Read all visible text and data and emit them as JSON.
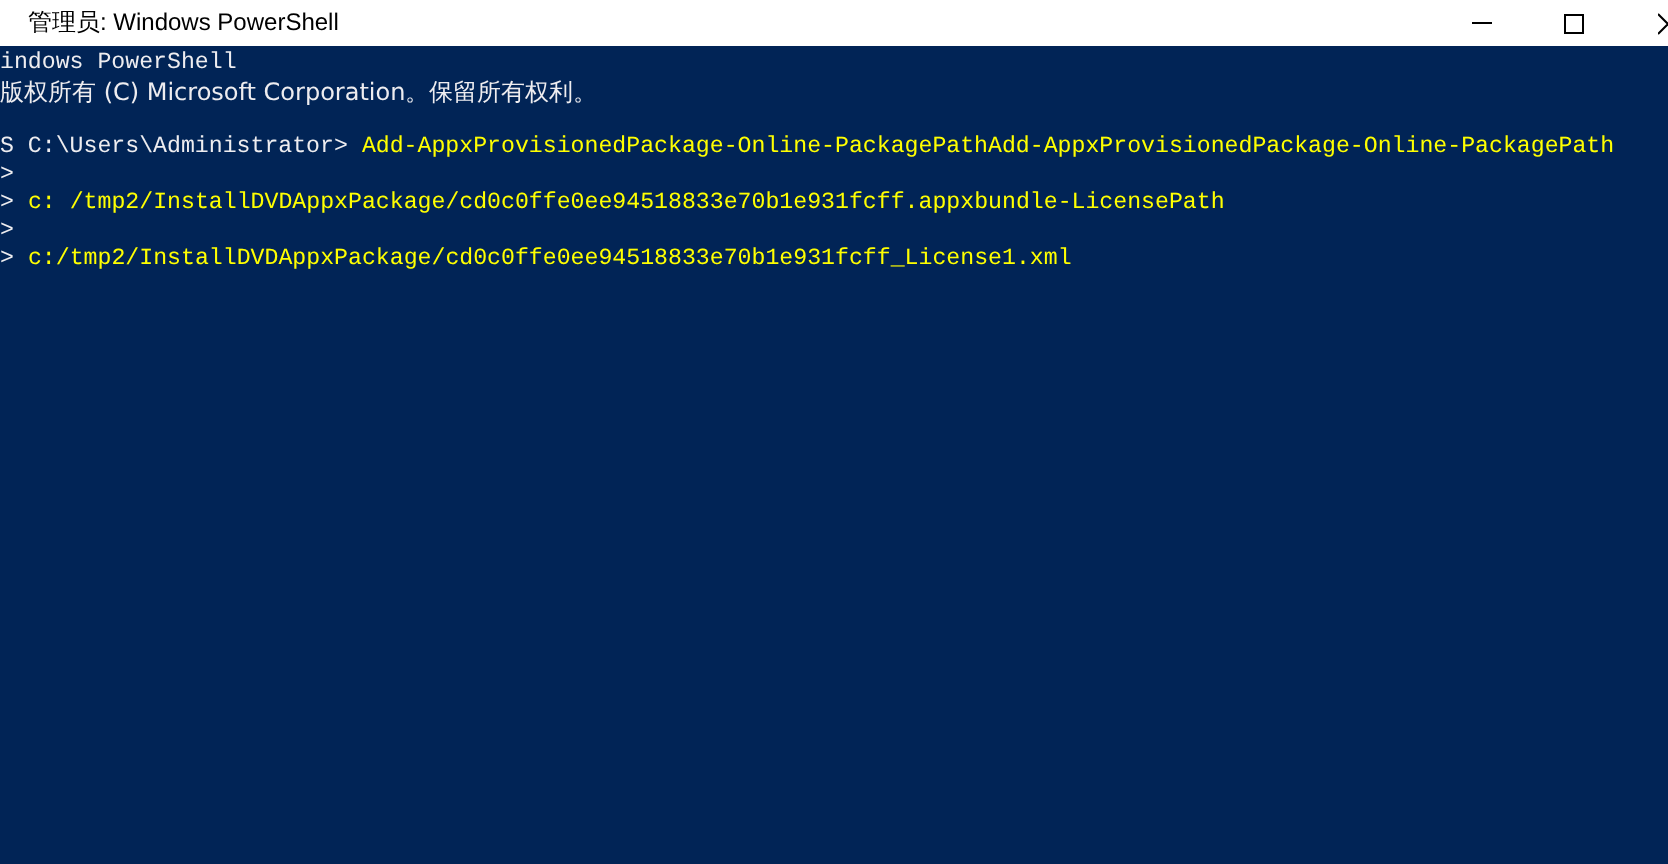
{
  "window": {
    "title": "管理员: Windows PowerShell"
  },
  "console": {
    "lines": [
      {
        "kind": "text",
        "segments": [
          {
            "text": "indows PowerShell",
            "kind": "output"
          }
        ]
      },
      {
        "kind": "text",
        "segments": [
          {
            "text": "版权所有 (C) Microsoft Corporation。保留所有权利。",
            "kind": "output"
          }
        ]
      },
      {
        "kind": "blank"
      },
      {
        "kind": "text",
        "segments": [
          {
            "text": "S C:\\Users\\Administrator>",
            "kind": "prompt"
          },
          {
            "text": "Add-AppxProvisionedPackage-Online-PackagePathAdd-AppxProvisionedPackage-Online-PackagePath",
            "kind": "command"
          }
        ]
      },
      {
        "kind": "text",
        "segments": [
          {
            "text": ">",
            "kind": "prompt"
          }
        ]
      },
      {
        "kind": "text",
        "segments": [
          {
            "text": ">",
            "kind": "prompt"
          },
          {
            "text": "c: /tmp2/InstallDVDAppxPackage/cd0c0ffe0ee94518833e70b1e931fcff.appxbundle-LicensePath",
            "kind": "command"
          }
        ]
      },
      {
        "kind": "text",
        "segments": [
          {
            "text": ">",
            "kind": "prompt"
          }
        ]
      },
      {
        "kind": "text",
        "segments": [
          {
            "text": ">",
            "kind": "prompt"
          },
          {
            "text": "c:/tmp2/InstallDVDAppxPackage/cd0c0ffe0ee94518833e70b1e931fcff_License1.xml",
            "kind": "command"
          }
        ]
      }
    ]
  }
}
